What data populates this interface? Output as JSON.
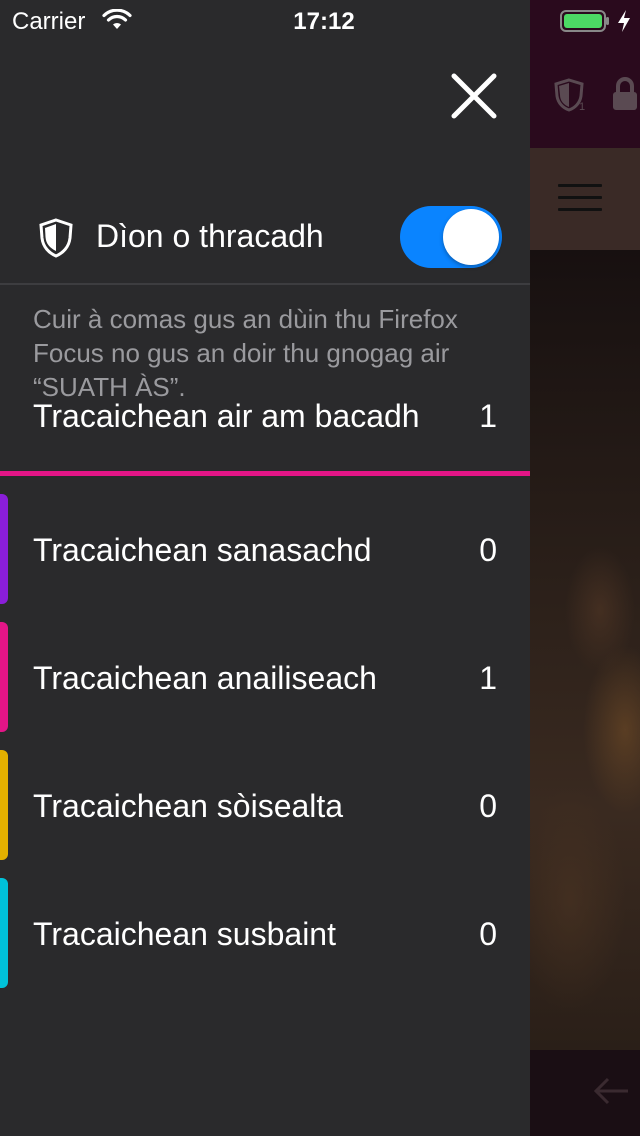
{
  "status_bar": {
    "carrier": "Carrier",
    "time": "17:12",
    "wifi_icon": "wifi-icon",
    "battery_icon": "battery-charging-icon"
  },
  "background_page": {
    "tracker_badge": "1"
  },
  "drawer": {
    "close_icon": "close-icon",
    "protection": {
      "label": "Dìon o thracadh",
      "enabled": true,
      "icon": "shield-icon",
      "switch_color": "#0a84ff"
    },
    "description": "Cuir à comas gus an dùin thu Firefox Focus no gus an doir thu gnogag air “SUATH ÀS”.",
    "blocked": {
      "label": "Tracaichean air am bacadh",
      "count": "1",
      "rule_color": "#e31587"
    },
    "categories": [
      {
        "label": "Tracaichean sanasachd",
        "count": "0",
        "color": "#8a1ed9"
      },
      {
        "label": "Tracaichean anailiseach",
        "count": "1",
        "color": "#e31587"
      },
      {
        "label": "Tracaichean sòisealta",
        "count": "0",
        "color": "#e3b000"
      },
      {
        "label": "Tracaichean susbaint",
        "count": "0",
        "color": "#00c2d9"
      }
    ]
  }
}
